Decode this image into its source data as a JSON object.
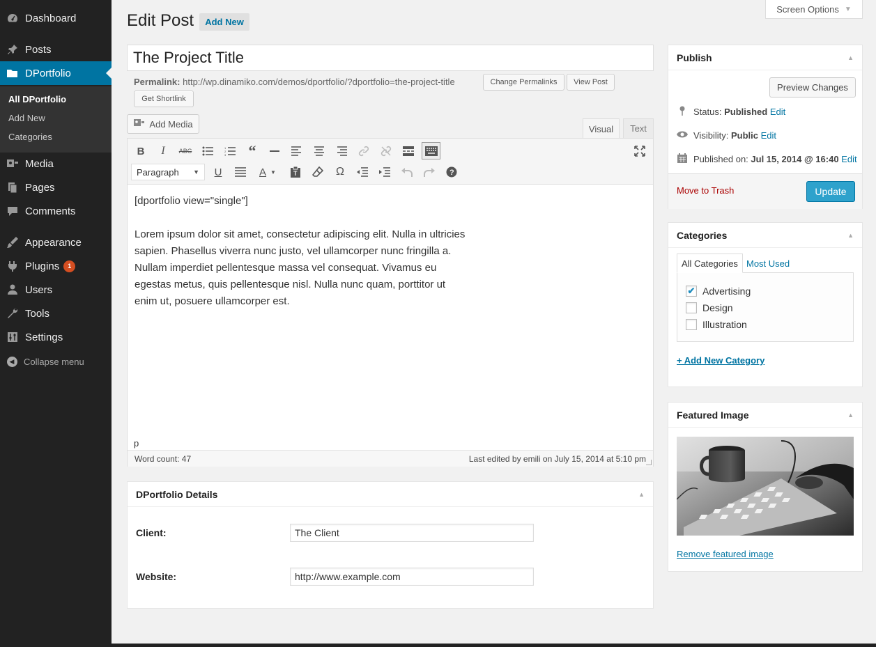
{
  "sidebar": {
    "items": [
      {
        "label": "Dashboard",
        "icon": "dashboard-icon"
      },
      {
        "label": "Posts",
        "icon": "pin-icon"
      },
      {
        "label": "DPortfolio",
        "icon": "folder-icon"
      },
      {
        "label": "Media",
        "icon": "media-icon"
      },
      {
        "label": "Pages",
        "icon": "pages-icon"
      },
      {
        "label": "Comments",
        "icon": "comments-icon"
      },
      {
        "label": "Appearance",
        "icon": "appearance-icon"
      },
      {
        "label": "Plugins",
        "icon": "plugins-icon",
        "badge": "1"
      },
      {
        "label": "Users",
        "icon": "users-icon"
      },
      {
        "label": "Tools",
        "icon": "wrench-icon"
      },
      {
        "label": "Settings",
        "icon": "settings-icon"
      }
    ],
    "submenu": [
      "All DPortfolio",
      "Add New",
      "Categories"
    ],
    "collapse_label": "Collapse menu"
  },
  "header": {
    "screen_options": "Screen Options",
    "title": "Edit Post",
    "add_new": "Add New"
  },
  "post": {
    "title": "The Project Title",
    "permalink_label": "Permalink:",
    "permalink_url": "http://wp.dinamiko.com/demos/dportfolio/?dportfolio=the-project-title",
    "change_permalinks": "Change Permalinks",
    "view_post": "View Post",
    "get_shortlink": "Get Shortlink"
  },
  "editor": {
    "add_media": "Add Media",
    "tab_visual": "Visual",
    "tab_text": "Text",
    "format": "Paragraph",
    "content": [
      "[dportfolio view=\"single\"]",
      "Lorem ipsum dolor sit amet, consectetur adipiscing elit. Nulla in ultricies sapien. Phasellus viverra nunc justo, vel ullamcorper nunc fringilla a. Nullam imperdiet pellentesque massa vel consequat. Vivamus eu egestas metus, quis pellentesque nisl. Nulla nunc quam, porttitor ut enim ut, posuere ullamcorper est."
    ],
    "path": "p",
    "word_count": "Word count: 47",
    "last_edited": "Last edited by emili on July 15, 2014 at 5:10 pm"
  },
  "details": {
    "title": "DPortfolio Details",
    "client_label": "Client:",
    "client_value": "The Client",
    "website_label": "Website:",
    "website_value": "http://www.example.com"
  },
  "publish": {
    "title": "Publish",
    "preview": "Preview Changes",
    "status_label": "Status:",
    "status_value": "Published",
    "visibility_label": "Visibility:",
    "visibility_value": "Public",
    "published_label": "Published on:",
    "published_value": "Jul 15, 2014 @ 16:40",
    "edit": "Edit",
    "trash": "Move to Trash",
    "update": "Update"
  },
  "categories": {
    "title": "Categories",
    "tab_all": "All Categories",
    "tab_used": "Most Used",
    "items": [
      {
        "label": "Advertising",
        "checked": true
      },
      {
        "label": "Design",
        "checked": false
      },
      {
        "label": "Illustration",
        "checked": false
      }
    ],
    "add_new": "+ Add New Category"
  },
  "featured": {
    "title": "Featured Image",
    "remove": "Remove featured image"
  },
  "colors": {
    "accent": "#0074a2",
    "update_button": "#2ea2cc",
    "sidebar": "#222222",
    "trash": "#aa0000"
  }
}
